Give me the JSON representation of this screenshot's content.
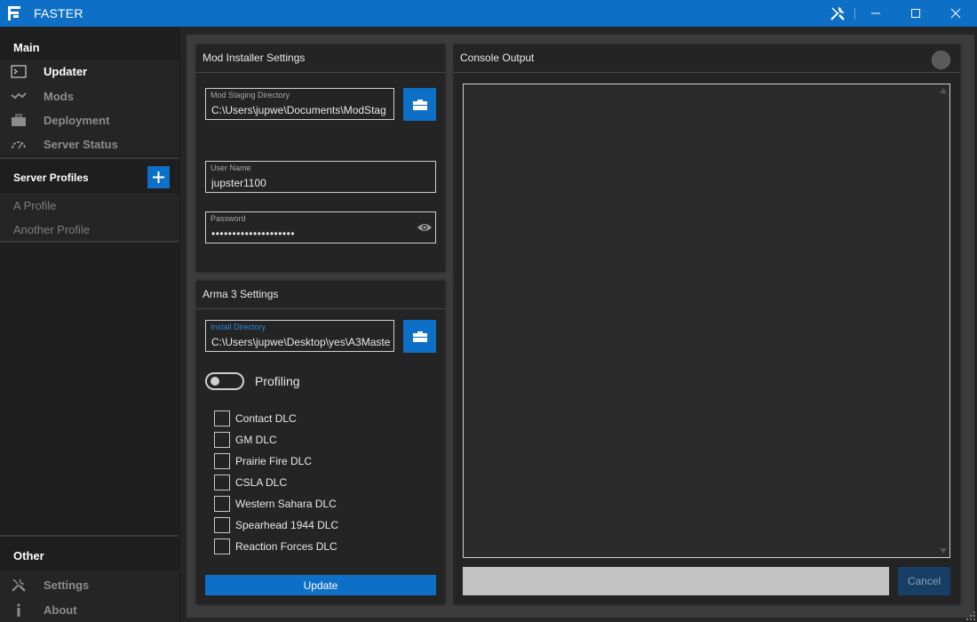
{
  "window": {
    "title": "FASTER",
    "accent_color": "#0e6fc6",
    "controls": [
      "tools-icon",
      "minimize-icon",
      "maximize-icon",
      "close-icon"
    ]
  },
  "sidebar": {
    "main_header": "Main",
    "main_items": [
      {
        "label": "Updater",
        "icon": "terminal-icon",
        "active": true
      },
      {
        "label": "Mods",
        "icon": "mods-icon",
        "active": false
      },
      {
        "label": "Deployment",
        "icon": "briefcase-icon",
        "active": false
      },
      {
        "label": "Server Status",
        "icon": "gauge-icon",
        "active": false
      }
    ],
    "profiles_header": "Server Profiles",
    "profiles": [
      "A Profile",
      "Another Profile"
    ],
    "other_header": "Other",
    "other_items": [
      {
        "label": "Settings",
        "icon": "tools-icon"
      },
      {
        "label": "About",
        "icon": "info-icon"
      }
    ]
  },
  "mod_installer": {
    "title": "Mod Installer Settings",
    "staging_label": "Mod Staging Directory",
    "staging_value": "C:\\Users\\jupwe\\Documents\\ModStag",
    "username_label": "User Name",
    "username_value": "jupster1100",
    "password_label": "Password",
    "password_value": "••••••••••••••••••••"
  },
  "arma": {
    "title": "Arma 3 Settings",
    "install_label": "Install Directory",
    "install_value": "C:\\Users\\jupwe\\Desktop\\yes\\A3Maste",
    "profiling_label": "Profiling",
    "profiling_on": false,
    "dlcs": [
      {
        "label": "Contact DLC",
        "checked": false
      },
      {
        "label": "GM DLC",
        "checked": false
      },
      {
        "label": "Prairie Fire DLC",
        "checked": false
      },
      {
        "label": "CSLA DLC",
        "checked": false
      },
      {
        "label": "Western Sahara DLC",
        "checked": false
      },
      {
        "label": "Spearhead 1944 DLC",
        "checked": false
      },
      {
        "label": "Reaction Forces DLC",
        "checked": false
      }
    ],
    "update_label": "Update"
  },
  "console": {
    "title": "Console Output",
    "progress": 0,
    "cancel_label": "Cancel"
  }
}
